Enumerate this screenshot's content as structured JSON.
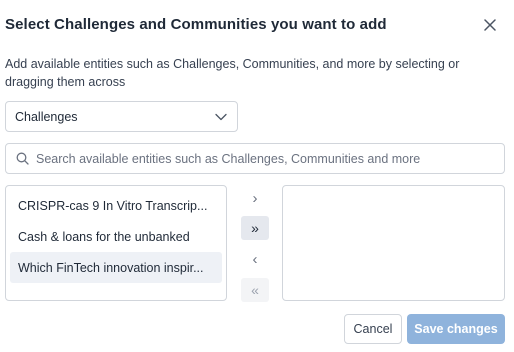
{
  "dialog": {
    "title": "Select Challenges and Communities you want to add",
    "close_icon": "close-icon",
    "description": "Add available entities such as Challenges, Communities, and more by selecting or dragging them across"
  },
  "entity_select": {
    "value": "Challenges",
    "icon": "chevron-down-icon"
  },
  "search": {
    "placeholder": "Search available entities such as Challenges, Communities and more",
    "value": "",
    "icon": "search-icon"
  },
  "available_list": {
    "items": [
      {
        "label": "CRISPR-cas 9 In Vitro Transcrip...",
        "selected": false
      },
      {
        "label": "Cash & loans for the unbanked",
        "selected": false
      },
      {
        "label": "Which FinTech innovation inspir...",
        "selected": true
      }
    ]
  },
  "selected_list": {
    "items": []
  },
  "move_buttons": {
    "move_right": "›",
    "move_all_right": "»",
    "move_left": "‹",
    "move_all_left": "«"
  },
  "footer": {
    "cancel_label": "Cancel",
    "save_label": "Save changes"
  },
  "colors": {
    "primary_disabled": "#8fb3dc",
    "selected_row": "#eef1f6",
    "border": "#d1d5db"
  }
}
